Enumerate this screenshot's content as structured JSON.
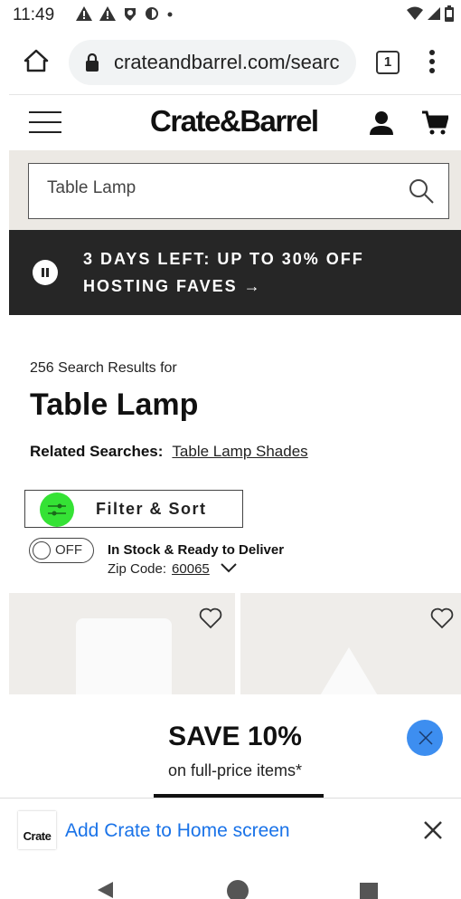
{
  "status_bar": {
    "time": "11:49",
    "notification_icons": [
      "warning-icon",
      "warning-icon",
      "shield-icon",
      "data-saver-icon",
      "dot-icon"
    ],
    "right_icons": [
      "wifi-icon",
      "signal-icon",
      "battery-icon"
    ]
  },
  "browser": {
    "url": "crateandbarrel.com/searc",
    "tab_count": "1"
  },
  "header": {
    "logo": "Crate&Barrel"
  },
  "search": {
    "value": "Table Lamp"
  },
  "promo": {
    "line1": "3 DAYS LEFT: UP TO 30% OFF",
    "line2": "HOSTING FAVES →"
  },
  "results": {
    "count_label": "256 Search Results for",
    "query": "Table Lamp",
    "related_label": "Related Searches:",
    "related_link": "Table Lamp Shades"
  },
  "filter": {
    "label": "Filter & Sort"
  },
  "stock_toggle": {
    "state": "OFF",
    "label": "In Stock & Ready to Deliver",
    "zip_label": "Zip Code:",
    "zip_value": "60065"
  },
  "save_popup": {
    "headline": "SAVE 10%",
    "subtext": "on full-price items*"
  },
  "add_to_home": {
    "icon_text": "Crate",
    "label": "Add Crate to Home screen"
  }
}
